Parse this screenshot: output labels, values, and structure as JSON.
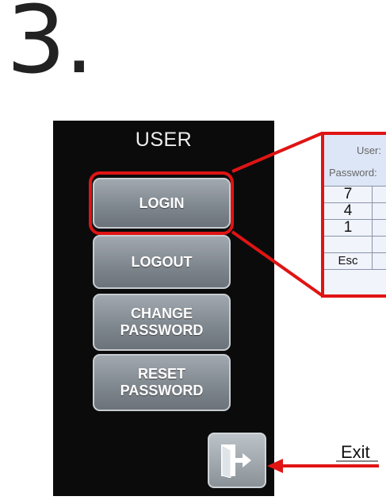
{
  "step_label": "3.",
  "panel": {
    "title": "USER",
    "buttons": {
      "login": "LOGIN",
      "logout": "LOGOUT",
      "change_password": "CHANGE\nPASSWORD",
      "reset_password": "RESET\nPASSWORD"
    },
    "exit_icon": "exit-door-icon"
  },
  "keypad": {
    "user_label": "User:",
    "password_label": "Password:",
    "keys": [
      "7",
      "4",
      "1",
      "",
      "Esc"
    ]
  },
  "annotation": {
    "exit_label": "Exit"
  },
  "colors": {
    "highlight": "#e01414",
    "panel_bg": "#0b0b0b",
    "button": "#8a9299"
  }
}
